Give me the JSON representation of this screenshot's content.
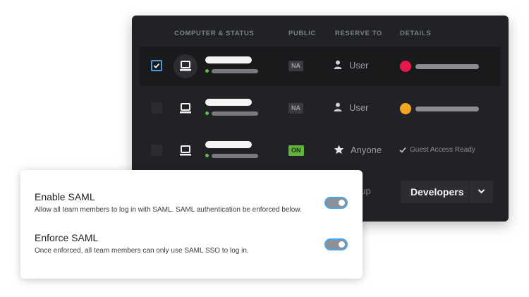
{
  "table": {
    "headers": {
      "computer": "COMPUTER & STATUS",
      "public": "PUBLIC",
      "reserve": "RESERVE TO",
      "details": "DETAILS"
    },
    "rows": [
      {
        "checked": true,
        "public": "NA",
        "reserve_icon": "user-icon",
        "reserve": "User",
        "detail_color": "#e8184a"
      },
      {
        "checked": false,
        "public": "NA",
        "reserve_icon": "user-icon",
        "reserve": "User",
        "detail_color": "#f4a623"
      },
      {
        "checked": false,
        "public": "ON",
        "reserve_icon": "star-icon",
        "reserve": "Anyone",
        "detail_text": "Guest Access Ready"
      }
    ],
    "group_text": "oup",
    "group_select": {
      "value": "Developers"
    }
  },
  "colors": {
    "panel": "#212225",
    "status_online": "#54c43c",
    "toggle_border": "#4aa6ea"
  },
  "saml": {
    "enable": {
      "title": "Enable SAML",
      "desc": "Allow all team members to log in with SAML. SAML authentication be enforced below.",
      "enabled": true
    },
    "enforce": {
      "title": "Enforce SAML",
      "desc": "Once enforced, all team members can only use SAML SSO to log in.",
      "enabled": true
    }
  }
}
